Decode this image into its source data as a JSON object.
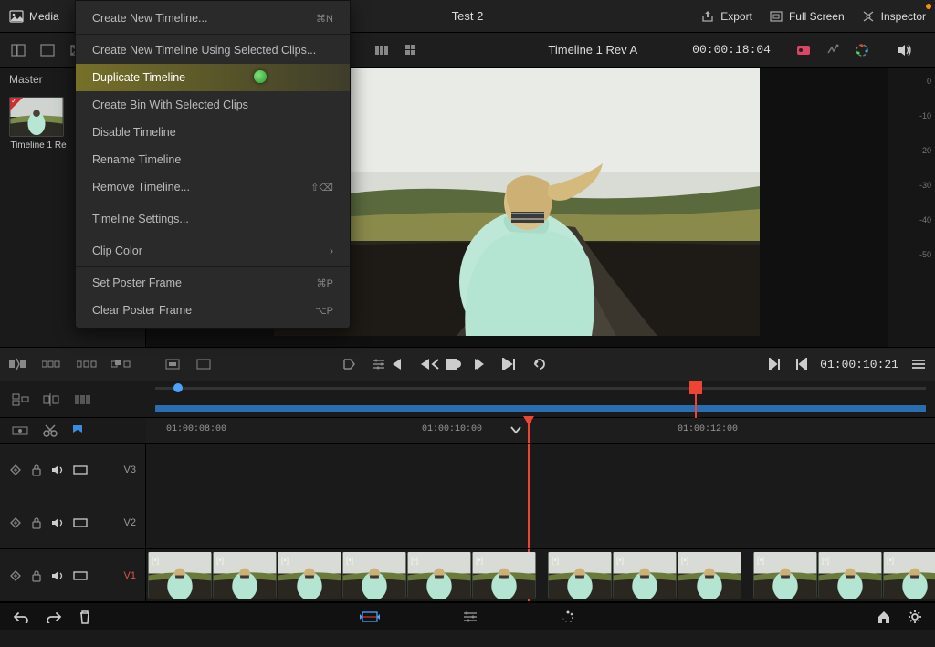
{
  "topbar": {
    "media_label": "Media",
    "title": "Test 2",
    "export": "Export",
    "fullscreen": "Full Screen",
    "inspector": "Inspector"
  },
  "toolbar": {
    "timeline_name": "Timeline 1 Rev A",
    "timecode": "00:00:18:04"
  },
  "media_pool": {
    "master": "Master",
    "thumb_label": "Timeline 1 Re"
  },
  "menu": {
    "items": [
      {
        "label": "Create New Timeline...",
        "shortcut": "⌘N"
      },
      {
        "label": "Create New Timeline Using Selected Clips..."
      },
      {
        "label": "Duplicate Timeline",
        "highlighted": true
      },
      {
        "label": "Create Bin With Selected Clips"
      },
      {
        "label": "Disable Timeline"
      },
      {
        "label": "Rename Timeline"
      },
      {
        "label": "Remove Timeline...",
        "shortcut": "⇧⌫"
      },
      {
        "label": "Timeline Settings..."
      },
      {
        "label": "Clip Color",
        "submenu": true
      },
      {
        "label": "Set Poster Frame",
        "shortcut": "⌘P"
      },
      {
        "label": "Clear Poster Frame",
        "shortcut": "⌥P"
      }
    ]
  },
  "meters": {
    "scale": [
      "0",
      "-10",
      "-20",
      "-30",
      "-40",
      "-50"
    ]
  },
  "transport": {
    "timecode": "01:00:10:21"
  },
  "timeline": {
    "time_labels": [
      {
        "text": "01:00:08:00",
        "pos": 22
      },
      {
        "text": "01:00:10:00",
        "pos": 302
      },
      {
        "text": "01:00:12:00",
        "pos": 582
      }
    ],
    "tracks": [
      {
        "name": "V3"
      },
      {
        "name": "V2"
      },
      {
        "name": "V1",
        "primary": true
      }
    ],
    "playhead_percent": 49.5,
    "range_marker_percent": 70.2
  }
}
